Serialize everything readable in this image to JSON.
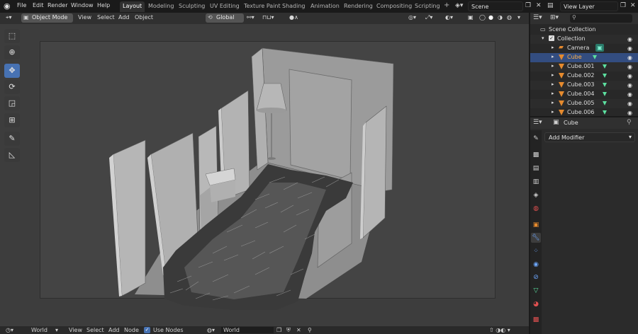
{
  "menubar": {
    "items": [
      "File",
      "Edit",
      "Render",
      "Window",
      "Help"
    ],
    "workspaces": [
      "Layout",
      "Modeling",
      "Sculpting",
      "UV Editing",
      "Texture Paint",
      "Shading",
      "Animation",
      "Rendering",
      "Compositing",
      "Scripting"
    ],
    "active_workspace": "Layout",
    "add_tab": "+",
    "scene": "Scene",
    "view_layer": "View Layer"
  },
  "viewport_header": {
    "mode": "Object Mode",
    "menus": [
      "View",
      "Select",
      "Add",
      "Object"
    ],
    "transform_orientation": "Global"
  },
  "toolbar": {
    "tools": [
      "select-box",
      "cursor",
      "move",
      "rotate",
      "scale",
      "transform",
      "annotate",
      "measure"
    ],
    "active_tool": "move"
  },
  "bottom_header": {
    "world_selector": "World",
    "menus": [
      "View",
      "Select",
      "Add",
      "Node"
    ],
    "use_nodes_label": "Use Nodes",
    "use_nodes_checked": true,
    "world_name": "World"
  },
  "outliner": {
    "root": "Scene Collection",
    "collection": "Collection",
    "items": [
      {
        "name": "Camera",
        "type": "camera",
        "selected": false
      },
      {
        "name": "Cube",
        "type": "mesh",
        "selected": true
      },
      {
        "name": "Cube.001",
        "type": "mesh",
        "selected": false
      },
      {
        "name": "Cube.002",
        "type": "mesh",
        "selected": false
      },
      {
        "name": "Cube.003",
        "type": "mesh",
        "selected": false
      },
      {
        "name": "Cube.004",
        "type": "mesh",
        "selected": false
      },
      {
        "name": "Cube.005",
        "type": "mesh",
        "selected": false
      },
      {
        "name": "Cube.006",
        "type": "mesh",
        "selected": false
      }
    ]
  },
  "properties": {
    "object_name": "Cube",
    "add_modifier_label": "Add Modifier",
    "tabs": [
      "tool",
      "render",
      "output",
      "view-layer",
      "scene",
      "world",
      "object",
      "modifiers",
      "particles",
      "physics",
      "constraints",
      "data",
      "material",
      "texture"
    ],
    "active_tab": "modifiers"
  },
  "colors": {
    "accent_blue": "#4772b3",
    "selected_row": "#334d80",
    "object_orange": "#e58a2e",
    "mesh_green": "#5ce0a0"
  }
}
